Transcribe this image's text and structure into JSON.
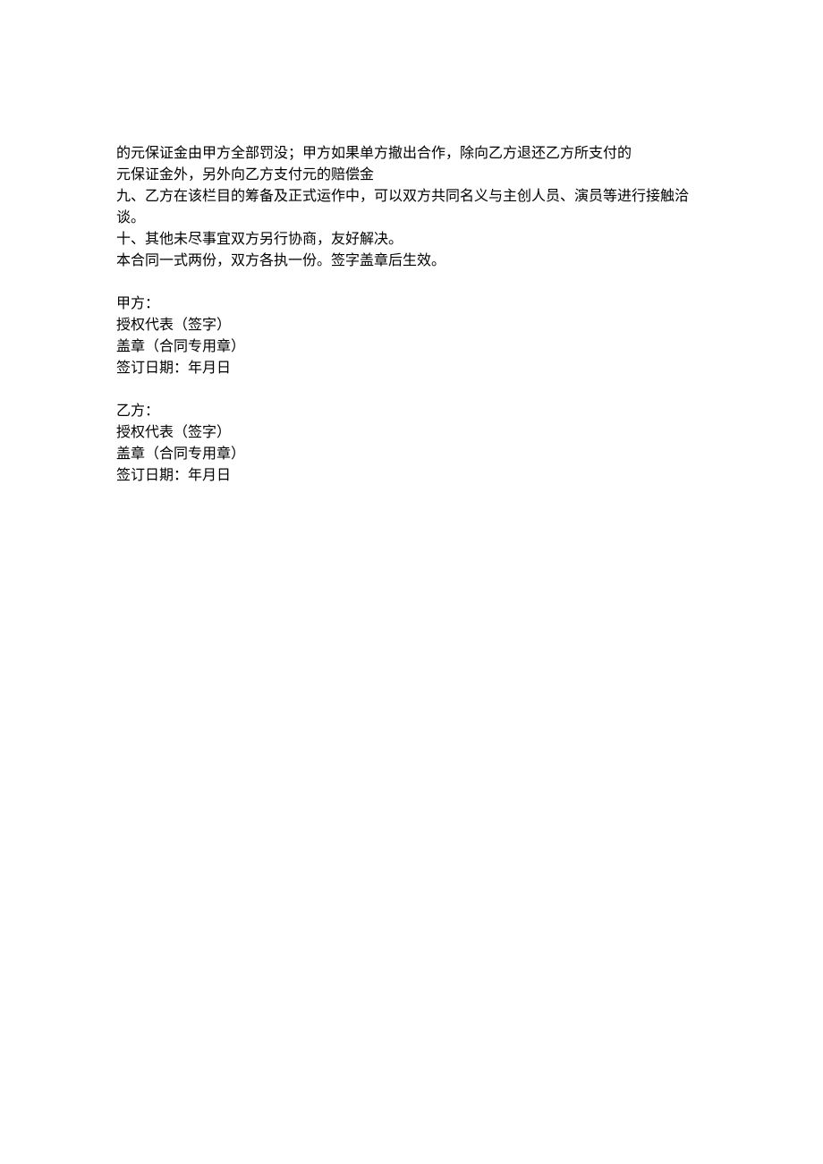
{
  "clauses": {
    "line1": "的元保证金由甲方全部罚没；甲方如果单方撤出合作，除向乙方退还乙方所支付的",
    "line2": "元保证金外，另外向乙方支付元的赔偿金",
    "line3": "九、乙方在该栏目的筹备及正式运作中，可以双方共同名义与主创人员、演员等进行接触洽谈。",
    "line4": "十、其他未尽事宜双方另行协商，友好解决。",
    "line5": "本合同一式两份，双方各执一份。签字盖章后生效。"
  },
  "partyA": {
    "title": "甲方：",
    "rep": "授权代表（签字）",
    "seal": "盖章（合同专用章）",
    "date": "签订日期：年月日"
  },
  "partyB": {
    "title": "乙方：",
    "rep": "授权代表（签字）",
    "seal": "盖章（合同专用章）",
    "date": "签订日期：年月日"
  }
}
